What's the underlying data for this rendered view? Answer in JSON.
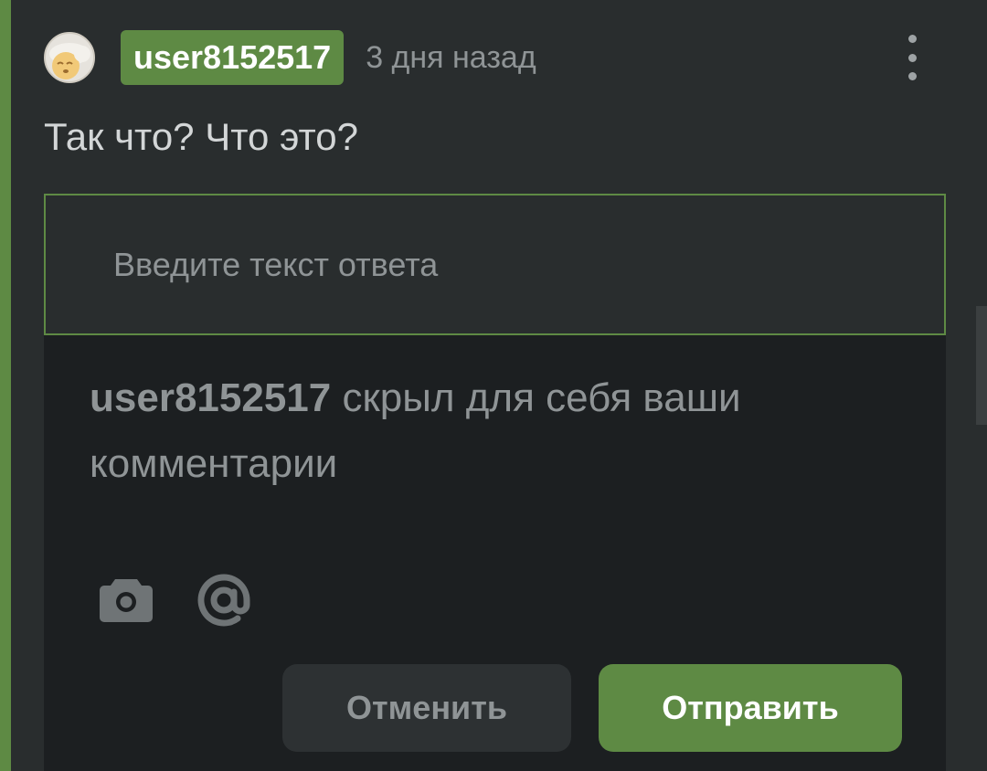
{
  "comment": {
    "username": "user8152517",
    "time_ago": "3 дня назад",
    "text": "Так что? Что это?",
    "avatar_icon": "avatar-face",
    "more_icon": "more-vertical-icon"
  },
  "reply": {
    "placeholder": "Введите текст ответа",
    "notice_user": "user8152517",
    "notice_text": " скрыл для себя ваши комментарии",
    "attach_icon": "camera-icon",
    "mention_icon": "at-sign-icon",
    "cancel_label": "Отменить",
    "send_label": "Отправить"
  },
  "colors": {
    "accent": "#5e8a44",
    "background": "#292d2e",
    "panel": "#1c1f21",
    "muted_text": "#8f9496"
  }
}
